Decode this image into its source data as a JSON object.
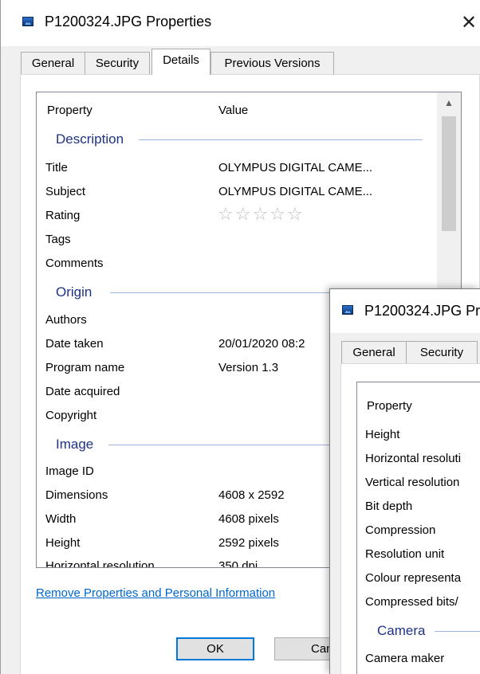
{
  "main_window": {
    "title": "P1200324.JPG Properties",
    "close_glyph": "✕",
    "tabs": [
      "General",
      "Security",
      "Details",
      "Previous Versions"
    ],
    "active_tab": "Details",
    "columns": {
      "property": "Property",
      "value": "Value"
    },
    "groups": {
      "description": {
        "label": "Description",
        "rows": [
          {
            "name": "Title",
            "value": "OLYMPUS DIGITAL CAME..."
          },
          {
            "name": "Subject",
            "value": "OLYMPUS DIGITAL CAME..."
          },
          {
            "name": "Rating",
            "value": "☆☆☆☆☆"
          },
          {
            "name": "Tags",
            "value": ""
          },
          {
            "name": "Comments",
            "value": ""
          }
        ]
      },
      "origin": {
        "label": "Origin",
        "rows": [
          {
            "name": "Authors",
            "value": ""
          },
          {
            "name": "Date taken",
            "value": "20/01/2020 08:2"
          },
          {
            "name": "Program name",
            "value": "Version 1.3"
          },
          {
            "name": "Date acquired",
            "value": ""
          },
          {
            "name": "Copyright",
            "value": ""
          }
        ]
      },
      "image": {
        "label": "Image",
        "rows": [
          {
            "name": "Image ID",
            "value": ""
          },
          {
            "name": "Dimensions",
            "value": "4608 x 2592"
          },
          {
            "name": "Width",
            "value": "4608 pixels"
          },
          {
            "name": "Height",
            "value": "2592 pixels"
          },
          {
            "name": "Horizontal resolution",
            "value": "350 dpi"
          }
        ]
      }
    },
    "remove_link": "Remove Properties and Personal Information",
    "ok_button": "OK",
    "cancel_button": "Can"
  },
  "second_window": {
    "title": "P1200324.JPG Pr",
    "tabs": [
      "General",
      "Security"
    ],
    "column_property": "Property",
    "rows": [
      "Height",
      "Horizontal resoluti",
      "Vertical resolution",
      "Bit depth",
      "Compression",
      "Resolution unit",
      "Colour representa",
      "Compressed bits/"
    ],
    "camera_group": "Camera",
    "camera_rows": [
      "Camera maker"
    ]
  },
  "colors": {
    "group_heading": "#1e3287",
    "link": "#0066cc",
    "default_button_border": "#0078d7"
  }
}
